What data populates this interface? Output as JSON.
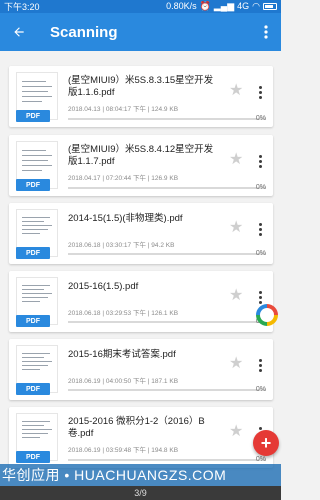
{
  "status_bar": {
    "time": "下午3:20",
    "speed": "0.80K/s",
    "network": "4G"
  },
  "toolbar": {
    "title": "Scanning",
    "back_icon": "arrow-left-icon",
    "menu_icon": "more-vert-icon"
  },
  "files": [
    {
      "name": "(星空MIUI9）米5S.8.3.15星空开发版1.1.6.pdf",
      "date": "2018.04.13",
      "time": "08:04:17 下午",
      "size": "124.9 KB",
      "progress": "0%",
      "badge": "PDF"
    },
    {
      "name": "(星空MIUI9）米5S.8.4.12星空开发版1.1.7.pdf",
      "date": "2018.04.17",
      "time": "07:20:44 下午",
      "size": "126.9 KB",
      "progress": "0%",
      "badge": "PDF"
    },
    {
      "name": "2014-15(1.5)(非物理类).pdf",
      "date": "2018.06.18",
      "time": "03:30:17 下午",
      "size": "94.2 KB",
      "progress": "0%",
      "badge": "PDF"
    },
    {
      "name": "2015-16(1.5).pdf",
      "date": "2018.06.18",
      "time": "03:29:53 下午",
      "size": "126.1 KB",
      "progress": "0%",
      "badge": "PDF"
    },
    {
      "name": "2015-16期末考试答案.pdf",
      "date": "2018.06.19",
      "time": "04:00:50 下午",
      "size": "187.1 KB",
      "progress": "0%",
      "badge": "PDF"
    },
    {
      "name": "2015-2016 微积分1-2（2016）B卷.pdf",
      "date": "2018.06.19",
      "time": "03:59:48 下午",
      "size": "194.8 KB",
      "progress": "0%",
      "badge": "PDF"
    }
  ],
  "watermark": "华创应用 • HUACHUANGZS.COM",
  "pager": "3/9",
  "colors": {
    "primary": "#2a89de",
    "fab": "#e53935"
  }
}
